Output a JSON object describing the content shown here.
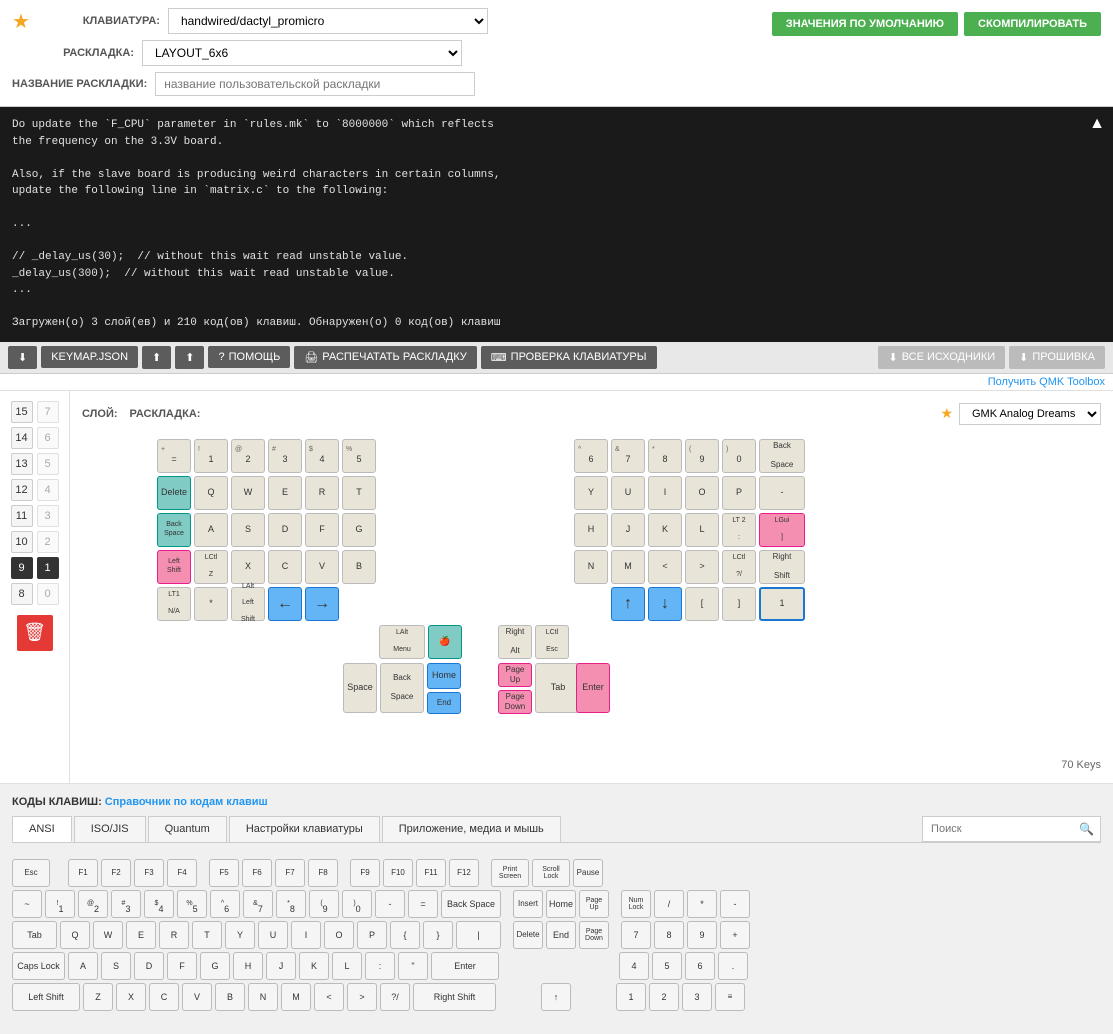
{
  "header": {
    "star_label": "★",
    "keyboard_label": "КЛАВИАТУРА:",
    "keyboard_value": "handwired/dactyl_promicro",
    "layout_label": "РАСКЛАДКА:",
    "layout_value": "LAYOUT_6x6",
    "layout_name_label": "НАЗВАНИЕ РАСКЛАДКИ:",
    "layout_name_placeholder": "название пользовательской раскладки",
    "btn_defaults": "ЗНАЧЕНИЯ ПО УМОЛЧАНИЮ",
    "btn_compile": "СКОМПИЛИРОВАТЬ"
  },
  "console": {
    "text": "Do update the `F_CPU` parameter in `rules.mk` to `8000000` which reflects\nthe frequency on the 3.3V board.\n\nAlso, if the slave board is producing weird characters in certain columns,\nupdate the following line in `matrix.c` to the following:\n\n...\n\n// _delay_us(30);  // without this wait read unstable value.\n_delay_us(300);  // without this wait read unstable value.\n...\n\nЗагружен(о) 3 слой(ев) и 210 код(ов) клавиш. Обнаружен(о) 0 код(ов) клавиш"
  },
  "toolbar": {
    "btn_keymap": "KEYMAP.JSON",
    "btn_help": "ПОМОЩЬ",
    "btn_print": "РАСПЕЧАТАТЬ РАСКЛАДКУ",
    "btn_check": "ПРОВЕРКА КЛАВИАТУРЫ",
    "btn_sources": "ВСЕ ИСХОДНИКИ",
    "btn_firmware": "ПРОШИВКА",
    "qmk_link": "Получить QMK Toolbox"
  },
  "keyboard_area": {
    "layer_label": "СЛОЙ:",
    "layout_label": "РАСКЛАДКА:",
    "colormap_label": "GMK Analog Dreams",
    "key_count": "70 Keys"
  },
  "layers": [
    {
      "num": 15,
      "slot": 7
    },
    {
      "num": 14,
      "slot": 6
    },
    {
      "num": 13,
      "slot": 5
    },
    {
      "num": 12,
      "slot": 4
    },
    {
      "num": 11,
      "slot": 3
    },
    {
      "num": 10,
      "slot": 2,
      "active": false
    },
    {
      "num": 9,
      "slot": 1,
      "active": true
    },
    {
      "num": 8,
      "slot": 0
    }
  ],
  "keycodes": {
    "header": "КОДЫ КЛАВИШ:",
    "link_text": "Справочник по кодам клавиш",
    "tabs": [
      "ANSI",
      "ISO/JIS",
      "Quantum",
      "Настройки клавиатуры",
      "Приложение, медиа и мышь"
    ],
    "active_tab": 0,
    "search_placeholder": "Поиск"
  }
}
